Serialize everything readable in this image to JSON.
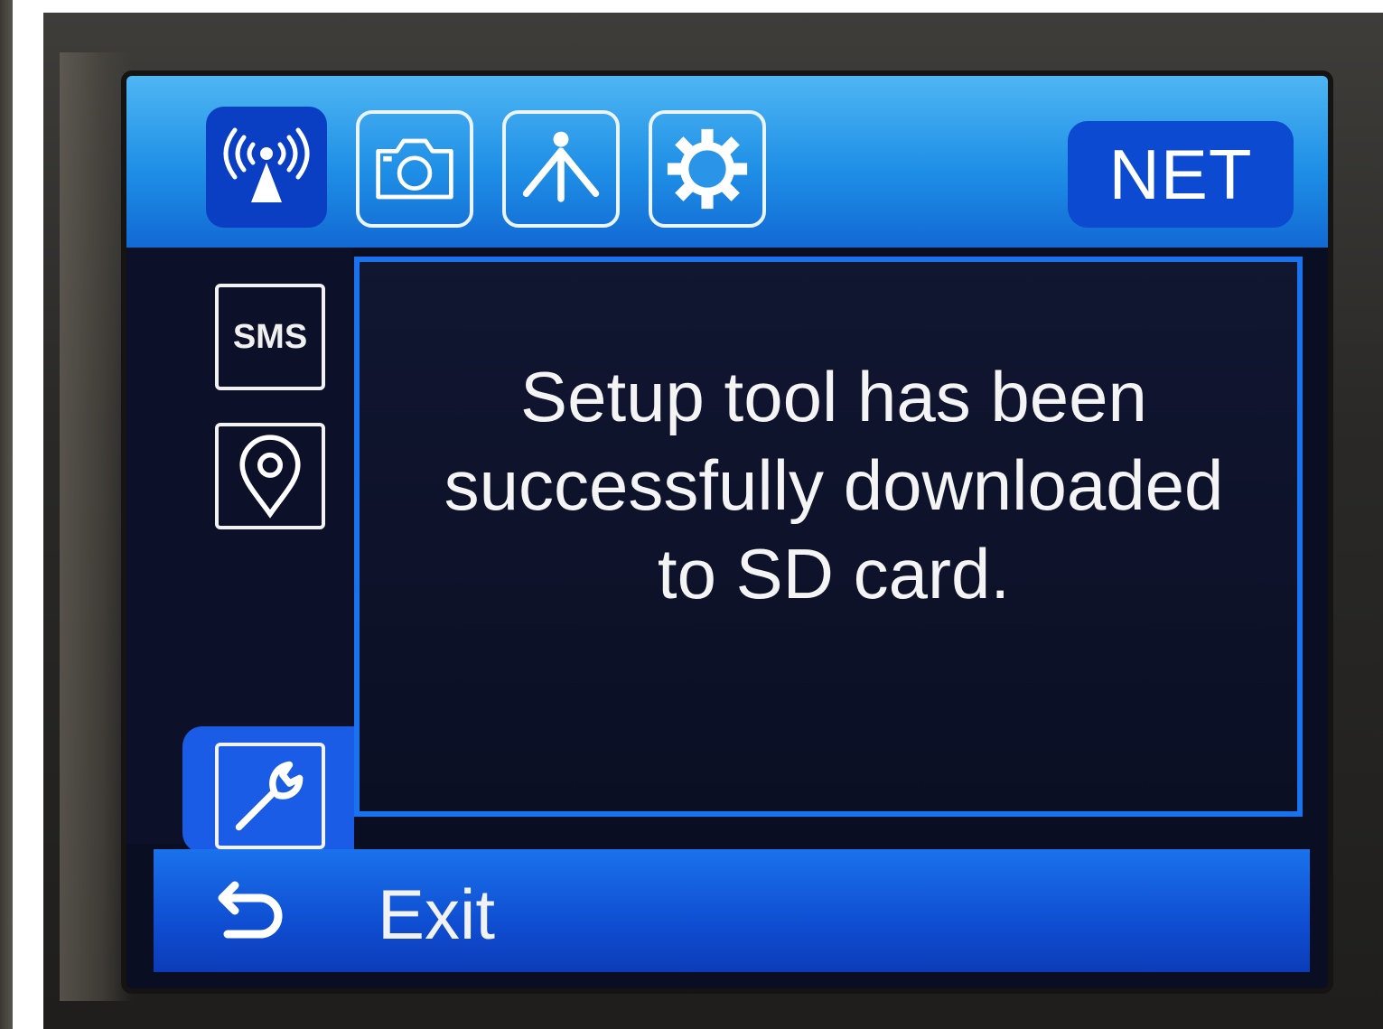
{
  "topbar": {
    "tabs": [
      {
        "icon": "signal-tower-icon",
        "active": true
      },
      {
        "icon": "camera-icon",
        "active": false
      },
      {
        "icon": "tripod-icon",
        "active": false
      },
      {
        "icon": "gear-icon",
        "active": false
      }
    ],
    "mode_label": "NET"
  },
  "sidebar": {
    "items": [
      {
        "icon": "sms-icon",
        "label": "SMS",
        "active": false
      },
      {
        "icon": "location-pin-icon",
        "active": false
      },
      {
        "icon": "wrench-icon",
        "active": true
      }
    ]
  },
  "dialog": {
    "message": "Setup tool has been successfully downloaded to SD card."
  },
  "footer": {
    "exit_icon": "back-arrow-icon",
    "exit_label": "Exit"
  },
  "colors": {
    "accent": "#1a73ee",
    "active_tab": "#0b3fc3",
    "screen_bg": "#0a0e22"
  }
}
